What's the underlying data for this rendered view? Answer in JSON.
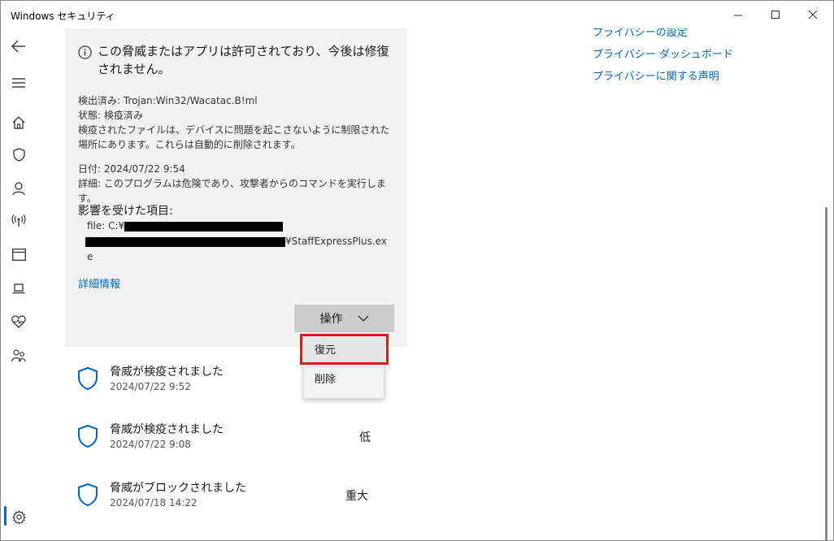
{
  "window": {
    "title": "Windows セキュリティ"
  },
  "card": {
    "warning": "この脅威またはアプリは許可されており、今後は修復されません。",
    "detected_label": "検出済み: Trojan:Win32/Wacatac.B!ml",
    "status_label": "状態: 検疫済み",
    "quarantine_note": "検疫されたファイルは、デバイスに問題を起こさないように制限された場所にあります。これらは自動的に削除されます。",
    "date_label": "日付: 2024/07/22 9:54",
    "details_label": "詳細: このプログラムは危険であり、攻撃者からのコマンドを実行します。",
    "affected_heading": "影響を受けた項目:",
    "file_prefix": "file: C:¥",
    "file_suffix": "¥StaffExpressPlus.ex",
    "file_wrap": "e",
    "more_info": "詳細情報",
    "action_label": "操作"
  },
  "menu": {
    "restore": "復元",
    "delete": "削除"
  },
  "history": [
    {
      "title": "脅威が検疫されました",
      "date": "2024/07/22 9:52",
      "severity": ""
    },
    {
      "title": "脅威が検疫されました",
      "date": "2024/07/22 9:08",
      "severity": "低"
    },
    {
      "title": "脅威がブロックされました",
      "date": "2024/07/18 14:22",
      "severity": "重大"
    }
  ],
  "links": {
    "privacy_settings": "プライバシーの設定",
    "privacy_dashboard": "プライバシー ダッシュボード",
    "privacy_statement": "プライバシーに関する声明"
  },
  "colors": {
    "accent": "#0067c0",
    "highlight": "#e0191b",
    "card_bg": "#f2f2f2"
  },
  "icons": {
    "rail": [
      "back-arrow-icon",
      "hamburger-menu-icon",
      "home-icon",
      "shield-icon",
      "account-icon",
      "wireless-icon",
      "app-browser-icon",
      "device-icon",
      "health-heart-icon",
      "family-icon",
      "settings-gear-icon"
    ]
  }
}
